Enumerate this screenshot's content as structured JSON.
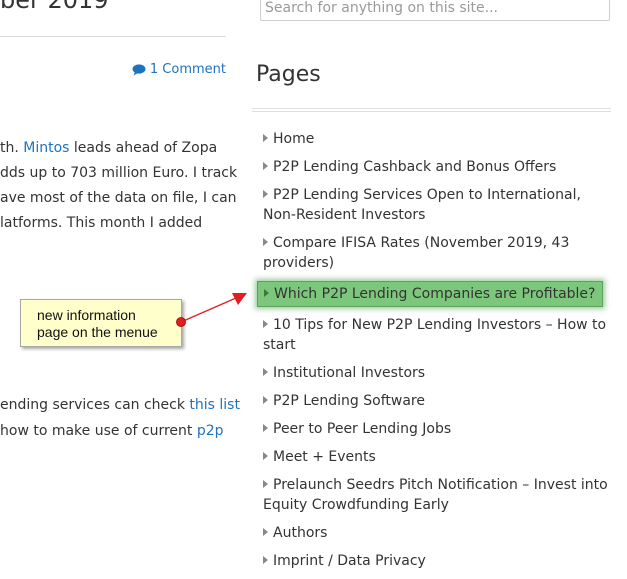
{
  "post": {
    "title_fragment": "ber 2019",
    "comments_label": "1 Comment",
    "text_lines": [
      {
        "pre": "th. ",
        "link": "Mintos",
        "post": " leads ahead of Zopa"
      },
      {
        "pre": "dds up to 703 million Euro. I track",
        "link": "",
        "post": ""
      },
      {
        "pre": "ave most of the data on file, I can",
        "link": "",
        "post": ""
      },
      {
        "pre": "latforms. This month I added",
        "link": "",
        "post": ""
      },
      {
        "pre": "ending services can check ",
        "link": "this list",
        "post": ""
      },
      {
        "pre": " how to make use of current ",
        "link": "p2p",
        "post": ""
      }
    ]
  },
  "callout": {
    "line1": "new information",
    "line2": "page on the menue"
  },
  "search": {
    "placeholder": "Search for anything on this site..."
  },
  "sidebar": {
    "title": "Pages",
    "pages": [
      "Home",
      "P2P Lending Cashback and Bonus Offers",
      "P2P Lending Services Open to International, Non-Resident Investors",
      "Compare IFISA Rates (November 2019, 43 providers)",
      "Which P2P Lending Companies are Profitable?",
      "10 Tips for New P2P Lending Investors – How to start",
      "Institutional Investors",
      "P2P Lending Software",
      "Peer to Peer Lending Jobs",
      "Meet + Events",
      "Prelaunch Seedrs Pitch Notification – Invest into Equity Crowdfunding Early",
      "Authors",
      "Imprint / Data Privacy"
    ]
  },
  "colors": {
    "link": "#1e73be",
    "highlight": "#7cc77c",
    "callout_bg": "#ffffcc",
    "arrow": "#e02020"
  }
}
